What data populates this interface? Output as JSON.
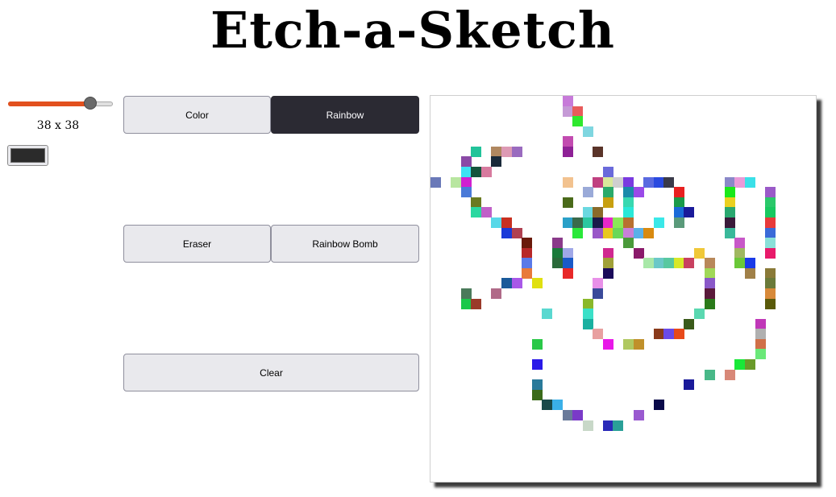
{
  "title": "Etch-a-Sketch",
  "slider": {
    "value": 38,
    "min": 1,
    "max": 45,
    "fill_color": "#e2501e"
  },
  "size_label": "38 x 38",
  "color_picker": {
    "value": "#2b2b2b"
  },
  "buttons": {
    "color": "Color",
    "rainbow": "Rainbow",
    "eraser": "Eraser",
    "rainbow_bomb": "Rainbow Bomb",
    "clear": "Clear"
  },
  "active_mode": "Rainbow",
  "grid": {
    "size": 38,
    "painted_cells": [
      [
        13,
        0,
        "#c77ad9"
      ],
      [
        13,
        1,
        "#c59ad6"
      ],
      [
        14,
        1,
        "#e85b5b"
      ],
      [
        14,
        2,
        "#2ee82e"
      ],
      [
        15,
        3,
        "#7fd6e0"
      ],
      [
        13,
        4,
        "#c24bb0"
      ],
      [
        13,
        5,
        "#8e2196"
      ],
      [
        16,
        5,
        "#5a3429"
      ],
      [
        4,
        5,
        "#22c39a"
      ],
      [
        6,
        5,
        "#b08860"
      ],
      [
        7,
        5,
        "#dd9ab4"
      ],
      [
        8,
        5,
        "#9a6bbf"
      ],
      [
        3,
        6,
        "#8a4aa6"
      ],
      [
        6,
        6,
        "#1a2a3a"
      ],
      [
        3,
        7,
        "#3de3f3"
      ],
      [
        4,
        7,
        "#15543d"
      ],
      [
        5,
        7,
        "#d77a9e"
      ],
      [
        17,
        7,
        "#6a6adb"
      ],
      [
        0,
        8,
        "#6a79b8"
      ],
      [
        2,
        8,
        "#b8e6a0"
      ],
      [
        3,
        8,
        "#d020d0"
      ],
      [
        13,
        8,
        "#f2c28f"
      ],
      [
        16,
        8,
        "#c04080"
      ],
      [
        17,
        8,
        "#d8e89a"
      ],
      [
        18,
        8,
        "#cfcfcf"
      ],
      [
        19,
        8,
        "#7a3ae0"
      ],
      [
        21,
        8,
        "#5a6ae0"
      ],
      [
        22,
        8,
        "#2a4ae0"
      ],
      [
        23,
        8,
        "#3a3a4a"
      ],
      [
        29,
        8,
        "#8a88c8"
      ],
      [
        30,
        8,
        "#ea9ad8"
      ],
      [
        31,
        8,
        "#3ae0e8"
      ],
      [
        3,
        9,
        "#4a7ad8"
      ],
      [
        15,
        9,
        "#9aaad8"
      ],
      [
        17,
        9,
        "#2aaa6a"
      ],
      [
        19,
        9,
        "#1a8aaa"
      ],
      [
        20,
        9,
        "#9a4ae8"
      ],
      [
        24,
        9,
        "#e82020"
      ],
      [
        29,
        9,
        "#1ae81a"
      ],
      [
        33,
        9,
        "#9a5ac8"
      ],
      [
        4,
        10,
        "#6a7a20"
      ],
      [
        13,
        10,
        "#4a6a1a"
      ],
      [
        17,
        10,
        "#c8a010"
      ],
      [
        19,
        10,
        "#38d8b0"
      ],
      [
        24,
        10,
        "#1a9a4a"
      ],
      [
        29,
        10,
        "#ead020"
      ],
      [
        33,
        10,
        "#2ac86a"
      ],
      [
        4,
        11,
        "#2ad8a0"
      ],
      [
        5,
        11,
        "#c060c8"
      ],
      [
        15,
        11,
        "#6ad8e0"
      ],
      [
        16,
        11,
        "#8a6a2a"
      ],
      [
        19,
        11,
        "#2ae8d8"
      ],
      [
        24,
        11,
        "#1a6ad8"
      ],
      [
        25,
        11,
        "#1a1a9a"
      ],
      [
        29,
        11,
        "#2aa870"
      ],
      [
        33,
        11,
        "#18c860"
      ],
      [
        6,
        12,
        "#58d8e8"
      ],
      [
        7,
        12,
        "#c83020"
      ],
      [
        13,
        12,
        "#2aa0c8"
      ],
      [
        14,
        12,
        "#3a6a4a"
      ],
      [
        15,
        12,
        "#2ac8a0"
      ],
      [
        16,
        12,
        "#1a1a4a"
      ],
      [
        17,
        12,
        "#e828c8"
      ],
      [
        18,
        12,
        "#8ae858"
      ],
      [
        19,
        12,
        "#b87030"
      ],
      [
        22,
        12,
        "#3ae8e8"
      ],
      [
        24,
        12,
        "#5a9a7a"
      ],
      [
        29,
        12,
        "#3a1a3a"
      ],
      [
        33,
        12,
        "#e83a3a"
      ],
      [
        7,
        13,
        "#1a3ad8"
      ],
      [
        8,
        13,
        "#b04050"
      ],
      [
        14,
        13,
        "#2ae83a"
      ],
      [
        16,
        13,
        "#9a58c8"
      ],
      [
        17,
        13,
        "#e8c820"
      ],
      [
        18,
        13,
        "#6ad858"
      ],
      [
        19,
        13,
        "#c880d8"
      ],
      [
        20,
        13,
        "#5ab0e8"
      ],
      [
        21,
        13,
        "#d88a10"
      ],
      [
        29,
        13,
        "#3ab89a"
      ],
      [
        33,
        13,
        "#3a6ad8"
      ],
      [
        9,
        14,
        "#6a1a0a"
      ],
      [
        12,
        14,
        "#8a3a8a"
      ],
      [
        19,
        14,
        "#4a9a3a"
      ],
      [
        30,
        14,
        "#c858c8"
      ],
      [
        33,
        14,
        "#8ae0d8"
      ],
      [
        9,
        15,
        "#b82828"
      ],
      [
        12,
        15,
        "#1a7a3a"
      ],
      [
        13,
        15,
        "#a0a8e8"
      ],
      [
        17,
        15,
        "#d02890"
      ],
      [
        20,
        15,
        "#8a1a6a"
      ],
      [
        26,
        15,
        "#f0c838"
      ],
      [
        30,
        15,
        "#a0b860"
      ],
      [
        33,
        15,
        "#e81a6a"
      ],
      [
        9,
        16,
        "#5a7ae8"
      ],
      [
        12,
        16,
        "#2a6a3a"
      ],
      [
        13,
        16,
        "#1a5ac8"
      ],
      [
        17,
        16,
        "#a0a038"
      ],
      [
        21,
        16,
        "#a8e8a8"
      ],
      [
        22,
        16,
        "#6ac8c8"
      ],
      [
        23,
        16,
        "#58c8a0"
      ],
      [
        24,
        16,
        "#d8e828"
      ],
      [
        25,
        16,
        "#c84060"
      ],
      [
        27,
        16,
        "#b8885a"
      ],
      [
        30,
        16,
        "#6ac838"
      ],
      [
        31,
        16,
        "#1a3ae8"
      ],
      [
        9,
        17,
        "#e87a3a"
      ],
      [
        13,
        17,
        "#e82828"
      ],
      [
        17,
        17,
        "#1a0a5a"
      ],
      [
        27,
        17,
        "#a0d858"
      ],
      [
        31,
        17,
        "#a08048"
      ],
      [
        33,
        17,
        "#8a7a38"
      ],
      [
        7,
        18,
        "#1a5a9a"
      ],
      [
        8,
        18,
        "#a858e8"
      ],
      [
        10,
        18,
        "#e0e010"
      ],
      [
        16,
        18,
        "#e890e8"
      ],
      [
        27,
        18,
        "#8a58c8"
      ],
      [
        33,
        18,
        "#6a7a3a"
      ],
      [
        3,
        19,
        "#4a7a5a"
      ],
      [
        6,
        19,
        "#b06a88"
      ],
      [
        16,
        19,
        "#3a4a9a"
      ],
      [
        27,
        19,
        "#5a1a3a"
      ],
      [
        33,
        19,
        "#d88a3a"
      ],
      [
        3,
        20,
        "#1ac84a"
      ],
      [
        4,
        20,
        "#9a3a2a"
      ],
      [
        15,
        20,
        "#8ab82a"
      ],
      [
        27,
        20,
        "#2a7a1a"
      ],
      [
        33,
        20,
        "#5a5a0a"
      ],
      [
        11,
        21,
        "#5ad8d0"
      ],
      [
        15,
        21,
        "#3ae0c8"
      ],
      [
        26,
        21,
        "#5ad8b0"
      ],
      [
        15,
        22,
        "#1ab0a0"
      ],
      [
        25,
        22,
        "#3a5a1a"
      ],
      [
        32,
        22,
        "#c038b8"
      ],
      [
        16,
        23,
        "#e8a0a0"
      ],
      [
        22,
        23,
        "#8a3a1a"
      ],
      [
        23,
        23,
        "#6a4ae8"
      ],
      [
        24,
        23,
        "#e84a1a"
      ],
      [
        32,
        23,
        "#b0b0b0"
      ],
      [
        10,
        24,
        "#2ac848"
      ],
      [
        17,
        24,
        "#e818e8"
      ],
      [
        19,
        24,
        "#b0c860"
      ],
      [
        20,
        24,
        "#c0902a"
      ],
      [
        32,
        24,
        "#d07048"
      ],
      [
        32,
        25,
        "#6ae878"
      ],
      [
        10,
        26,
        "#2a1ae8"
      ],
      [
        30,
        26,
        "#18e838"
      ],
      [
        31,
        26,
        "#6a9a2a"
      ],
      [
        27,
        27,
        "#48b888"
      ],
      [
        29,
        27,
        "#d88878"
      ],
      [
        10,
        28,
        "#2a7a9a"
      ],
      [
        25,
        28,
        "#1a1a9a"
      ],
      [
        10,
        29,
        "#3a6a1a"
      ],
      [
        11,
        30,
        "#1a4a4a"
      ],
      [
        12,
        30,
        "#3ab0e8"
      ],
      [
        22,
        30,
        "#0a0a4a"
      ],
      [
        13,
        31,
        "#6a7a9a"
      ],
      [
        14,
        31,
        "#7a3ac8"
      ],
      [
        20,
        31,
        "#9a5ad0"
      ],
      [
        15,
        32,
        "#c8d8c8"
      ],
      [
        17,
        32,
        "#2a2ab8"
      ],
      [
        18,
        32,
        "#2aa098"
      ]
    ]
  }
}
